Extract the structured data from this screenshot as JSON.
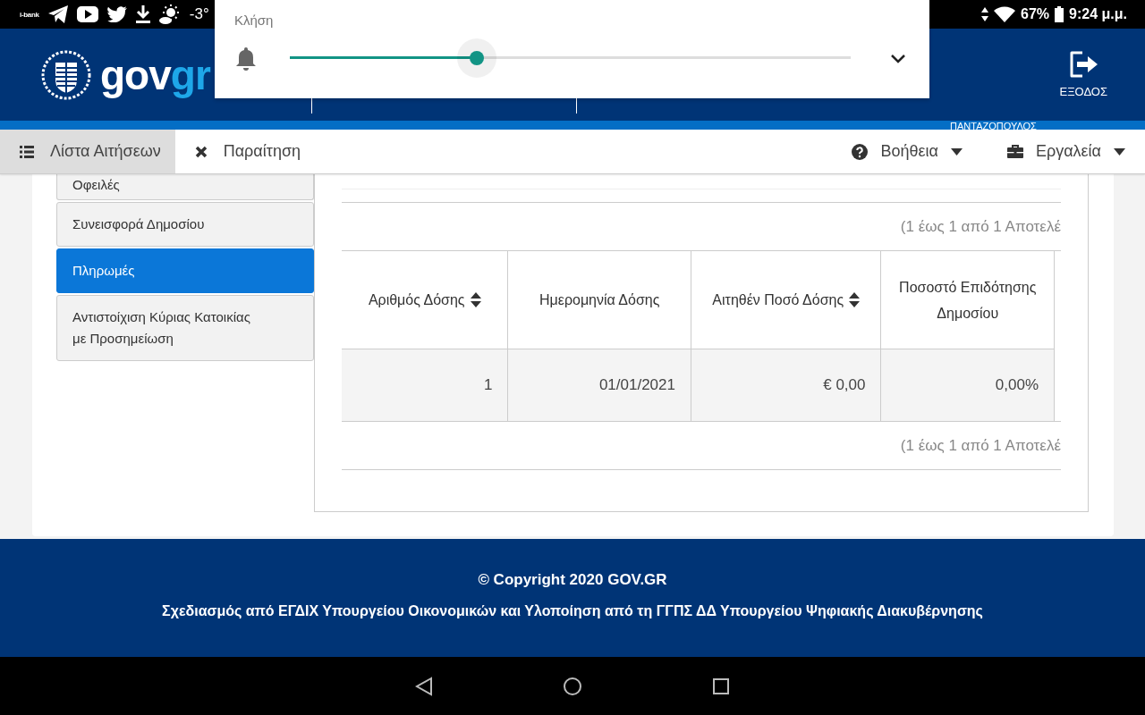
{
  "status_bar": {
    "bank_label": "i-bank",
    "temperature": "-3°",
    "battery": "67%",
    "time": "9:24 μ.μ."
  },
  "volume_panel": {
    "label": "Κλήση",
    "level": 0.334
  },
  "header": {
    "logo_part_1": "gov",
    "logo_part_2": "gr",
    "exit_label": "ΕΞΟΔΟΣ",
    "user_name": "ΠΑΝΤΑΖΟΠΟΥΛΟΣ"
  },
  "toolbar": {
    "left": [
      {
        "label": "Λίστα Αιτήσεων",
        "selected": true
      },
      {
        "label": "Παραίτηση",
        "selected": false
      }
    ],
    "right": [
      {
        "label": "Βοήθεια"
      },
      {
        "label": "Εργαλεία"
      }
    ]
  },
  "sidebar": {
    "items": [
      {
        "label": "Οφειλές",
        "selected": false
      },
      {
        "label": "Συνεισφορά Δημοσίου",
        "selected": false
      },
      {
        "label": "Πληρωμές",
        "selected": true
      },
      {
        "label": "Αντιστοίχιση Κύριας Κατοικίας με Προσημείωση",
        "selected": false
      }
    ]
  },
  "table": {
    "pagination_top": "(1 έως 1 από 1 Αποτελέ",
    "columns": [
      {
        "label": "Αριθμός Δόσης",
        "sortable": true
      },
      {
        "label": "Ημερομηνία Δόσης",
        "sortable": false
      },
      {
        "label": "Αιτηθέν Ποσό Δόσης",
        "sortable": true
      },
      {
        "label": "Ποσοστό Επιδότησης Δημοσίου",
        "sortable": false
      }
    ],
    "rows": [
      [
        "1",
        "01/01/2021",
        "€ 0,00",
        "0,00%"
      ]
    ],
    "pagination_bottom": "(1 έως 1 από 1 Αποτελέ"
  },
  "footer": {
    "copyright": "© Copyright 2020 GOV.GR",
    "credits": "Σχεδιασμός από ΕΓΔΙΧ Υπουργείου Οικονομικών και Υλοποίηση από τη ΓΓΠΣ ΔΔ Υπουργείου Ψηφιακής Διακυβέρνησης"
  }
}
